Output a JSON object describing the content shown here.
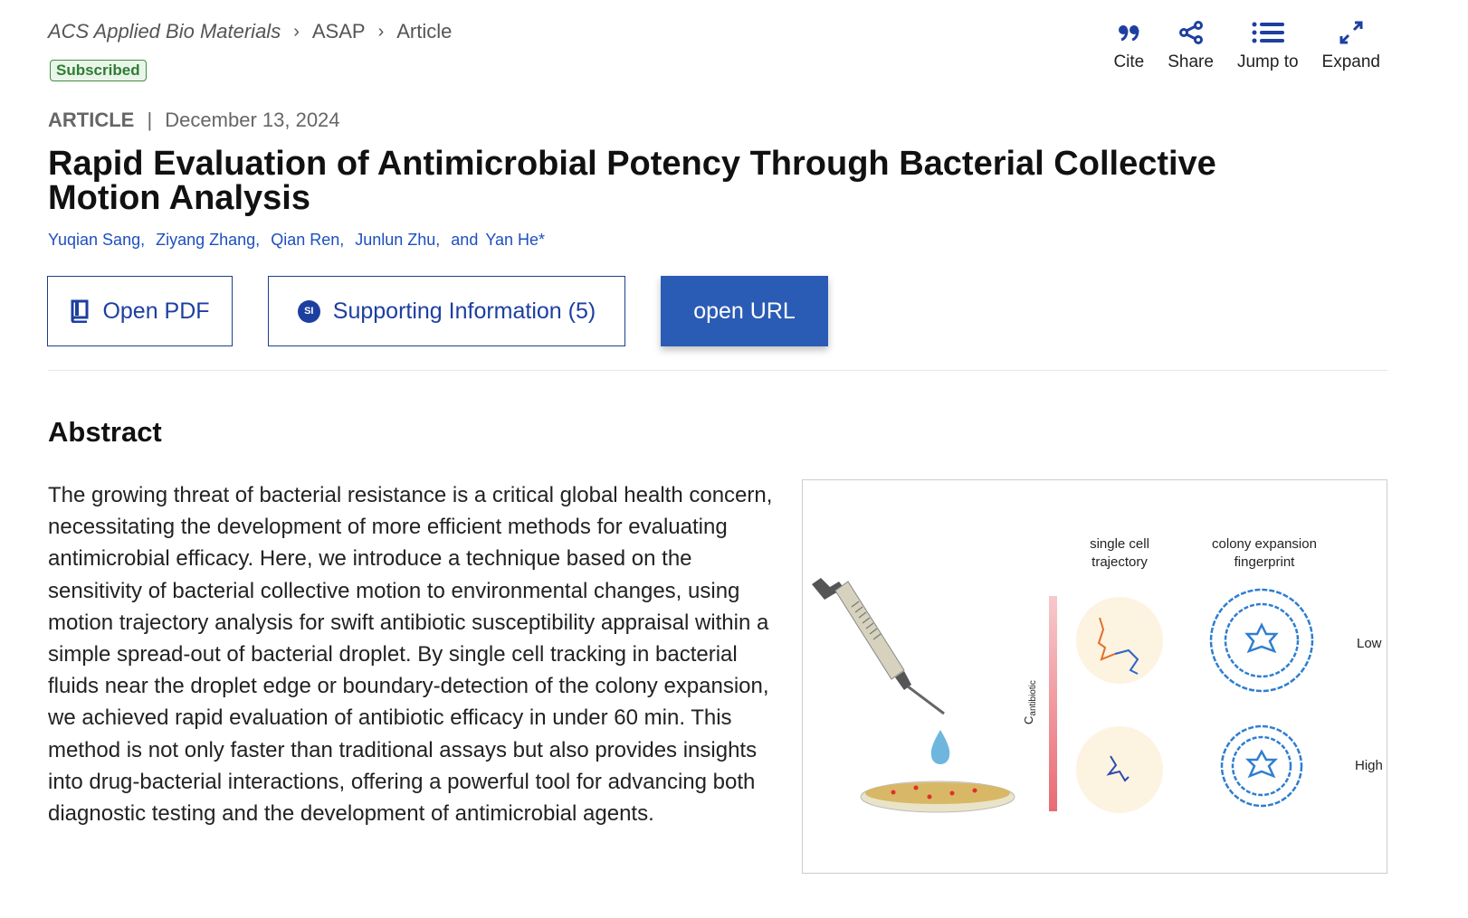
{
  "breadcrumb": {
    "journal": "ACS Applied Bio Materials",
    "section": "ASAP",
    "page": "Article"
  },
  "badge": "Subscribed",
  "actions": [
    {
      "label": "Cite",
      "icon": "quote-icon"
    },
    {
      "label": "Share",
      "icon": "share-icon"
    },
    {
      "label": "Jump to",
      "icon": "list-icon"
    },
    {
      "label": "Expand",
      "icon": "expand-icon"
    }
  ],
  "article": {
    "type": "ARTICLE",
    "separator": "|",
    "date": "December 13, 2024",
    "title": "Rapid Evaluation of Antimicrobial Potency Through Bacterial Collective Motion Analysis",
    "authors": [
      "Yuqian Sang,",
      "Ziyang Zhang,",
      "Qian Ren,",
      "Junlun Zhu,",
      "and",
      "Yan He*"
    ]
  },
  "buttons": {
    "pdf": "Open PDF",
    "si": "Supporting Information (5)",
    "si_icon_text": "SI",
    "url": "open URL"
  },
  "abstract": {
    "heading": "Abstract",
    "text": "The growing threat of bacterial resistance is a critical global health concern, necessitating the development of more efficient methods for evaluating antimicrobial efficacy. Here, we introduce a technique based on the sensitivity of bacterial collective motion to environmental changes, using motion trajectory analysis for swift antibiotic susceptibility appraisal within a simple spread-out of bacterial droplet. By single cell tracking in bacterial fluids near the droplet edge or boundary-detection of the colony expansion, we achieved rapid evaluation of antibiotic efficacy in under 60 min. This method is not only faster than traditional assays but also provides insights into drug-bacterial interactions, offering a powerful tool for advancing both diagnostic testing and the development of antimicrobial agents."
  },
  "figure": {
    "col1a": "single cell",
    "col1b": "trajectory",
    "col2a": "colony expansion",
    "col2b": "fingerprint",
    "axis_c": "C",
    "axis_sub": "antibiotic",
    "low": "Low",
    "high": "High"
  },
  "colors": {
    "accent": "#1d3fa0",
    "link": "#1d4fbf",
    "button": "#2b5cb5",
    "badge": "#2e7d32"
  }
}
